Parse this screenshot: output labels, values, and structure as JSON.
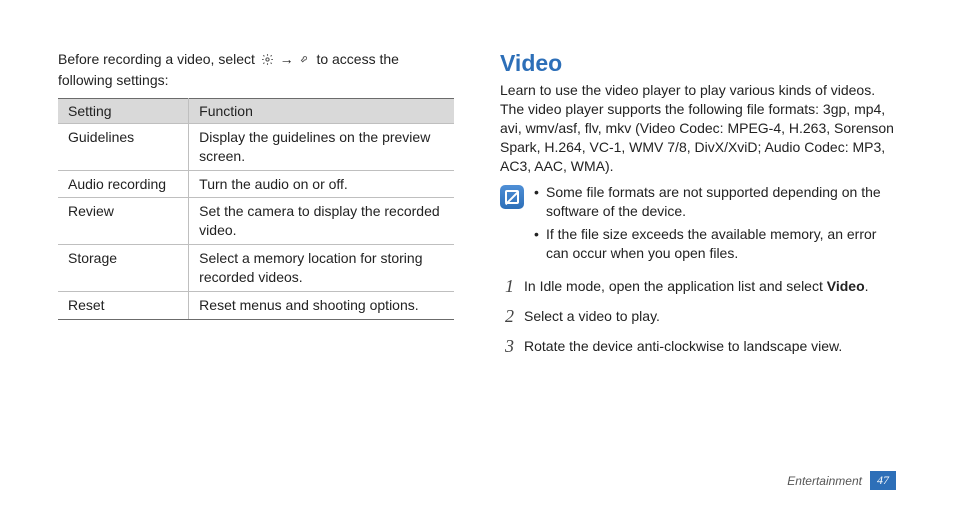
{
  "leftColumn": {
    "introPrefix": "Before recording a video, select ",
    "introArrow": " → ",
    "introSuffix": " to access the following settings:",
    "tableHeaders": {
      "setting": "Setting",
      "function": "Function"
    },
    "rows": [
      {
        "setting": "Guidelines",
        "function": "Display the guidelines on the preview screen."
      },
      {
        "setting": "Audio recording",
        "function": "Turn the audio on or off."
      },
      {
        "setting": "Review",
        "function": "Set the camera to display the recorded video."
      },
      {
        "setting": "Storage",
        "function": "Select a memory location for storing recorded videos."
      },
      {
        "setting": "Reset",
        "function": "Reset menus and shooting options."
      }
    ]
  },
  "rightColumn": {
    "heading": "Video",
    "body": "Learn to use the video player to play various kinds of videos. The video player supports the following file formats: 3gp, mp4, avi, wmv/asf, flv, mkv (Video Codec: MPEG-4, H.263, Sorenson Spark, H.264, VC-1, WMV 7/8, DivX/XviD; Audio Codec: MP3, AC3, AAC, WMA).",
    "notes": [
      "Some file formats are not supported depending on the software of the device.",
      "If the file size exceeds the available memory, an error can occur when you open files."
    ],
    "steps": [
      {
        "num": "1",
        "textPrefix": "In Idle mode, open the application list and select ",
        "bold": "Video",
        "textSuffix": "."
      },
      {
        "num": "2",
        "textPrefix": "Select a video to play.",
        "bold": "",
        "textSuffix": ""
      },
      {
        "num": "3",
        "textPrefix": "Rotate the device anti-clockwise to landscape view.",
        "bold": "",
        "textSuffix": ""
      }
    ]
  },
  "footer": {
    "section": "Entertainment",
    "page": "47"
  }
}
